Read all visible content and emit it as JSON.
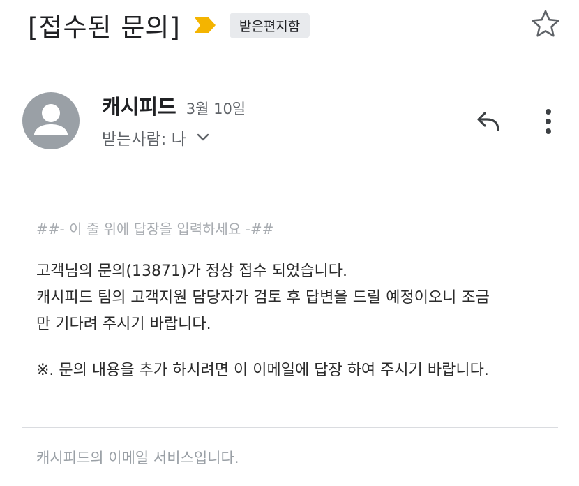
{
  "subject": {
    "title": "[접수된 문의]",
    "label_chip": "받은편지함",
    "importance_color": "#f4b400"
  },
  "sender": {
    "name": "캐시피드",
    "date": "3월 10일",
    "recipient": "받는사람: 나",
    "avatar_icon": "person-icon"
  },
  "actions": {
    "reply_icon": "reply-icon",
    "more_icon": "more-vert-icon",
    "star_icon": "star-outline-icon"
  },
  "email_body": {
    "reply_line": "##- 이 줄 위에 답장을 입력하세요 -##",
    "lines": [
      "고객님의 문의(13871)가 정상 접수 되었습니다.",
      "캐시피드 팀의 고객지원 담당자가 검토 후 답변을 드릴 예정이오니 조금",
      "만 기다려 주시기 바랍니다."
    ],
    "note": "※. 문의 내용을 추가 하시려면 이 이메일에 답장 하여 주시기 바랍니다."
  },
  "footer": {
    "text": "캐시피드의 이메일 서비스입니다."
  }
}
